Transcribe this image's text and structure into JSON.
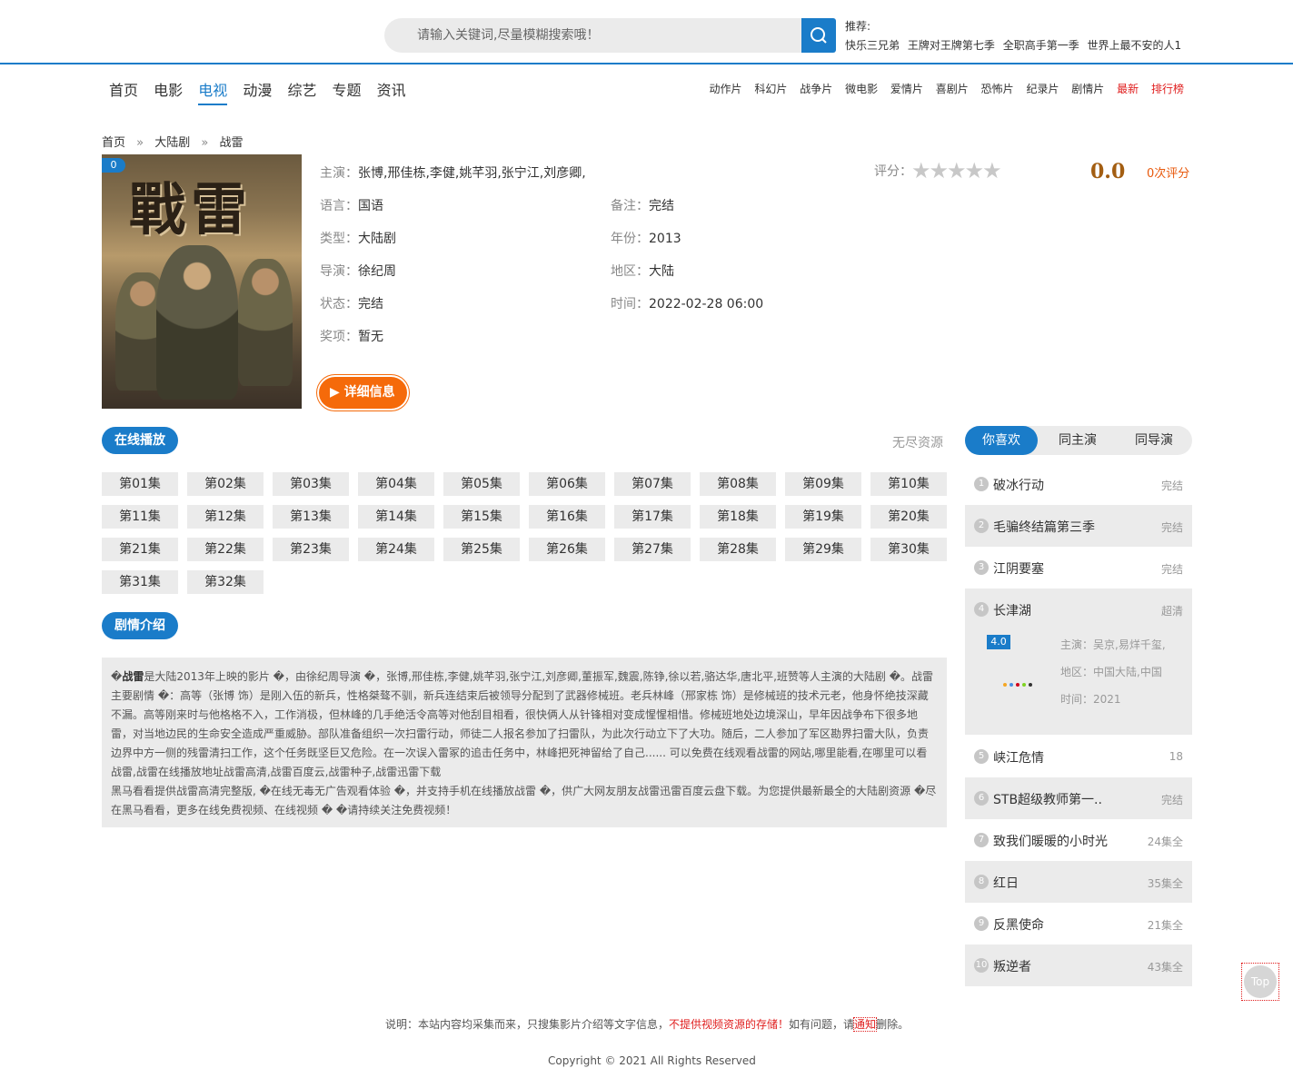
{
  "header": {
    "search_placeholder": "请输入关键词,尽量模糊搜索哦！",
    "recommend_label": "推荐:",
    "recommend_items": [
      "快乐三兄弟",
      "王牌对王牌第七季",
      "全职高手第一季",
      "世界上最不安的人1"
    ]
  },
  "nav": {
    "items": [
      "首页",
      "电影",
      "电视",
      "动漫",
      "综艺",
      "专题",
      "资讯"
    ],
    "active": "电视"
  },
  "genres": [
    "动作片",
    "科幻片",
    "战争片",
    "微电影",
    "爱情片",
    "喜剧片",
    "恐怖片",
    "纪录片",
    "剧情片",
    "最新",
    "排行榜"
  ],
  "breadcrumb": {
    "home": "首页",
    "sep": "»",
    "category": "大陆剧",
    "current": "战雷"
  },
  "poster": {
    "badge": "0",
    "art_text": "戰雷"
  },
  "info": {
    "actors_label": "主演：",
    "actors": "张博,邢佳栋,李健,姚芊羽,张宁江,刘彦卿,",
    "lang_label": "语言：",
    "lang": "国语",
    "remark_label": "备注：",
    "remark": "完结",
    "type_label": "类型：",
    "type": "大陆剧",
    "year_label": "年份：",
    "year": "2013",
    "director_label": "导演：",
    "director": "徐纪周",
    "area_label": "地区：",
    "area": "大陆",
    "status_label": "状态：",
    "status": "完结",
    "time_label": "时间：",
    "time": "2022-02-28 06:00",
    "award_label": "奖项：",
    "award": "暂无",
    "rating_label": "评分：",
    "score": "0.0",
    "score_count": "0次评分",
    "stars_filled": 0,
    "detail_button": "▶ 详细信息"
  },
  "play": {
    "title": "在线播放",
    "source": "无尽资源",
    "episodes": [
      "第01集",
      "第02集",
      "第03集",
      "第04集",
      "第05集",
      "第06集",
      "第07集",
      "第08集",
      "第09集",
      "第10集",
      "第11集",
      "第12集",
      "第13集",
      "第14集",
      "第15集",
      "第16集",
      "第17集",
      "第18集",
      "第19集",
      "第20集",
      "第21集",
      "第22集",
      "第23集",
      "第24集",
      "第25集",
      "第26集",
      "第27集",
      "第28集",
      "第29集",
      "第30集",
      "第31集",
      "第32集"
    ]
  },
  "synopsis": {
    "title": "剧情介绍",
    "lead_mark": "�",
    "lead_title": "战雷",
    "body": "是大陆2013年上映的影片 �，由徐纪周导演 �，张博,邢佳栋,李健,姚芊羽,张宁江,刘彦卿,董振军,魏震,陈铮,徐以若,骆达华,唐北平,班赞等人主演的大陆剧 �。战雷主要剧情 �：高等（张博 饰）是刚入伍的新兵，性格桀骜不驯，新兵连结束后被领导分配到了武器修械班。老兵林峰（邢家栋 饰）是修械班的技术元老，他身怀绝技深藏不漏。高等刚来时与他格格不入，工作消极，但林峰的几手绝活令高等对他刮目相看，很快俩人从针锋相对变成惺惺相惜。修械班地处边境深山，早年因战争布下很多地雷，对当地边民的生命安全造成严重威胁。部队准备组织一次扫雷行动，师徒二人报名参加了扫雷队，为此次行动立下了大功。随后，二人参加了军区勘界扫雷大队，负责边界中方一侧的残雷清扫工作，这个任务既坚巨又危险。在一次误入雷冢的追击任务中，林峰把死神留给了自己...... 可以免费在线观看战雷的网站,哪里能看,在哪里可以看战雷,战雷在线播放地址战雷高清,战雷百度云,战雷种子,战雷迅雷下载",
    "body2": "黑马看看提供战雷高清完整版, �在线无毒无广告观看体验 �，并支持手机在线播放战雷 �，供广大网友朋友战雷迅雷百度云盘下载。为您提供最新最全的大陆剧资源 �尽在黑马看看，更多在线免费视频、在线视频 � �请持续关注免费视频！"
  },
  "sidebar": {
    "tabs": [
      "你喜欢",
      "同主演",
      "同导演"
    ],
    "active_tab": "你喜欢",
    "items": [
      {
        "num": "1",
        "name": "破冰行动",
        "status": "完结"
      },
      {
        "num": "2",
        "name": "毛骗终结篇第三季",
        "status": "完结"
      },
      {
        "num": "3",
        "name": "江阴要塞",
        "status": "完结"
      },
      {
        "num": "4",
        "name": "长津湖",
        "status": "超清"
      },
      {
        "num": "5",
        "name": "峡江危情",
        "status": "18"
      },
      {
        "num": "6",
        "name": "STB超级教师第一..",
        "status": "完结"
      },
      {
        "num": "7",
        "name": "致我们暖暖的小时光",
        "status": "24集全"
      },
      {
        "num": "8",
        "name": "红日",
        "status": "35集全"
      },
      {
        "num": "9",
        "name": "反黑使命",
        "status": "21集全"
      },
      {
        "num": "10",
        "name": "叛逆者",
        "status": "43集全"
      }
    ],
    "featured": {
      "score": "4.0",
      "actors": "主演：吴京,易烊千玺,",
      "area": "地区：中国大陆,中国",
      "time": "时间：2021"
    }
  },
  "footer": {
    "notice_a": "说明：本站内容均采集而来，只搜集影片介绍等文字信息，",
    "notice_red": "不提供视频资源的存储！",
    "notice_b": "如有问题，请",
    "notice_link": "通知",
    "notice_c": "删除。",
    "copyright": "Copyright © 2021 All Rights Reserved",
    "top_label": "Top"
  },
  "colors": {
    "accent": "#1a7cc9",
    "orange": "#f56a0a",
    "red": "#e01f1f",
    "panel": "#ebebeb"
  }
}
